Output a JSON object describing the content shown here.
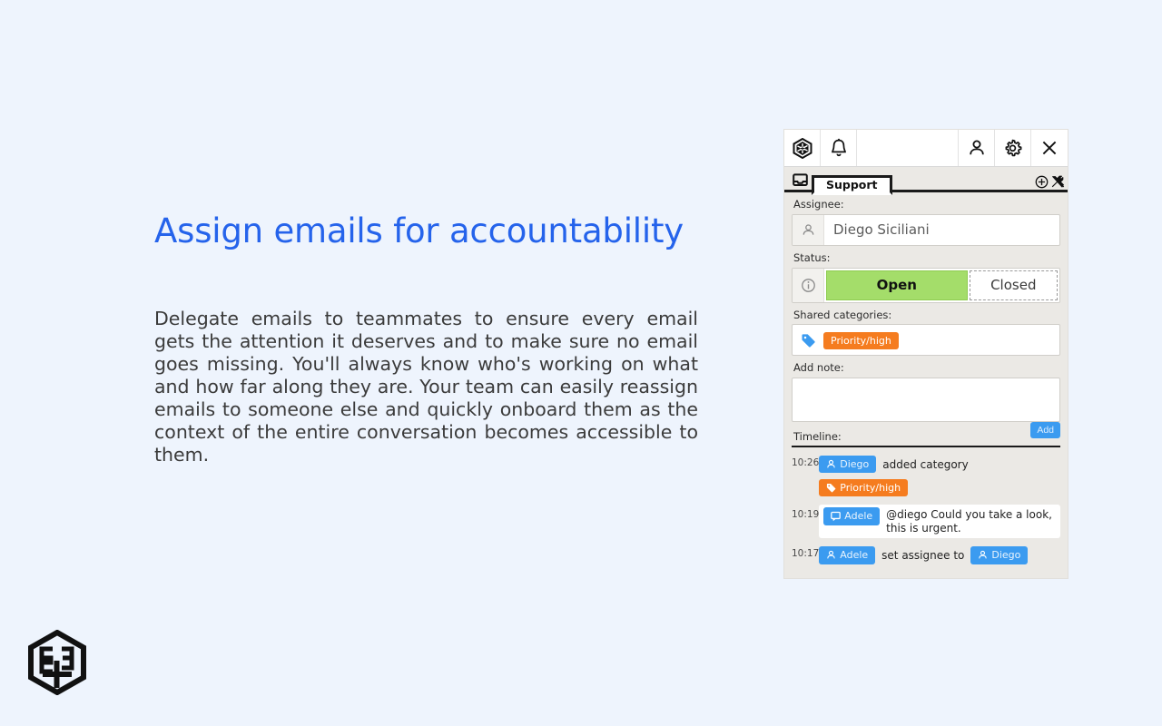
{
  "marketing": {
    "headline": "Assign emails for accountability",
    "body": "Delegate emails to teammates to ensure every email gets the attention it deserves and to make sure no email goes missing. You'll always know who's working on what and how far along they are. Your team can easily reassign emails to someone else and quickly onboard them as the context of the entire conversation becomes accessible to them.",
    "headline_color": "#2563eb",
    "background_color": "#eef4fd"
  },
  "logo": {
    "name": "hexagon-brand-logo"
  },
  "app": {
    "toolbar": {
      "items": [
        {
          "name": "app-logo-icon",
          "label": ""
        },
        {
          "name": "notifications-bell-icon",
          "label": ""
        },
        {
          "name": "account-person-icon",
          "label": ""
        },
        {
          "name": "settings-gear-icon",
          "label": ""
        },
        {
          "name": "close-x-icon",
          "label": ""
        }
      ]
    },
    "tabstrip": {
      "inbox_icon": "inbox-tray-icon",
      "active_tab": "Support",
      "add_icon": "plus-circle-icon",
      "tools_icon": "tools-hammer-wrench-icon"
    },
    "assignee": {
      "label": "Assignee:",
      "value": "Diego Siciliani",
      "icon": "person-icon"
    },
    "status": {
      "label": "Status:",
      "icon": "info-circle-icon",
      "options": [
        "Open",
        "Closed"
      ],
      "selected": "Open",
      "selected_color": "#a4dd6a"
    },
    "categories": {
      "label": "Shared categories:",
      "icon": "tag-icon",
      "chips": [
        {
          "text": "Priority/high",
          "color": "#f57c1f"
        }
      ]
    },
    "note": {
      "label": "Add note:",
      "value": "",
      "placeholder": "",
      "add_button": "Add",
      "add_button_color": "#3b9bf0"
    },
    "timeline": {
      "label": "Timeline:",
      "entries": [
        {
          "time": "10:26",
          "actor": "Diego",
          "actor_icon": "person-icon",
          "action": "added category",
          "chip": "Priority/high",
          "chip_icon": "tag-icon",
          "chip_color": "#f57c1f",
          "message": "",
          "style": "plain"
        },
        {
          "time": "10:19",
          "actor": "Adele",
          "actor_icon": "comment-icon",
          "action": "",
          "chip": "",
          "chip_icon": "",
          "chip_color": "",
          "message": "@diego Could you take a look, this is urgent.",
          "style": "card"
        },
        {
          "time": "10:17",
          "actor": "Adele",
          "actor_icon": "person-icon",
          "action": "set assignee to",
          "chip": "Diego",
          "chip_icon": "person-icon",
          "chip_color": "#3b9bf0",
          "message": "",
          "style": "plain"
        }
      ]
    }
  }
}
